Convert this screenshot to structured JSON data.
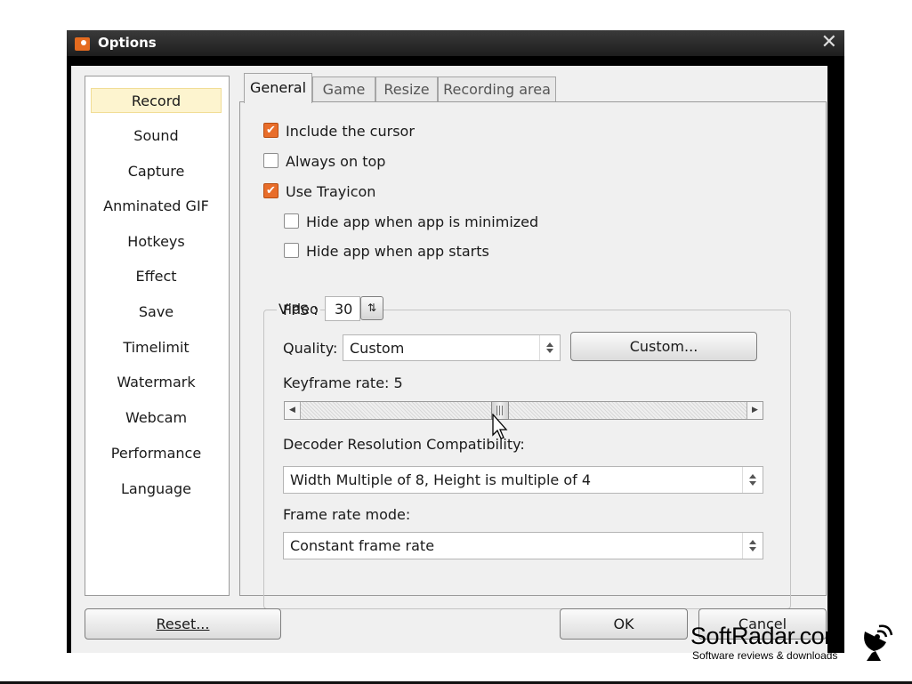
{
  "window": {
    "title": "Options",
    "close_glyph": "✕"
  },
  "nav": {
    "items": [
      {
        "label": "Record",
        "selected": true
      },
      {
        "label": "Sound"
      },
      {
        "label": "Capture"
      },
      {
        "label": "Anminated GIF"
      },
      {
        "label": "Hotkeys"
      },
      {
        "label": "Effect"
      },
      {
        "label": "Save"
      },
      {
        "label": "Timelimit"
      },
      {
        "label": "Watermark"
      },
      {
        "label": "Webcam"
      },
      {
        "label": "Performance"
      },
      {
        "label": "Language"
      }
    ]
  },
  "tabs": [
    {
      "label": "General",
      "active": true
    },
    {
      "label": "Game"
    },
    {
      "label": "Resize"
    },
    {
      "label": "Recording area"
    }
  ],
  "general": {
    "include_cursor": {
      "label": "Include the cursor",
      "checked": true
    },
    "always_on_top": {
      "label": "Always on top",
      "checked": false
    },
    "use_trayicon": {
      "label": "Use Trayicon",
      "checked": true
    },
    "hide_minimized": {
      "label": "Hide app when app is minimized",
      "checked": false
    },
    "hide_starts": {
      "label": "Hide app when app starts",
      "checked": false
    }
  },
  "video": {
    "group_title": "Video",
    "fps_label": "FPS :",
    "fps_value": "30",
    "quality_label": "Quality:",
    "quality_value": "Custom",
    "custom_button": "Custom...",
    "keyframe_label": "Keyframe rate: 5",
    "keyframe_value": 5,
    "decoder_label": "Decoder Resolution Compatibility:",
    "decoder_value": "Width Multiple of 8, Height is multiple of 4",
    "framerate_label": "Frame rate mode:",
    "framerate_value": "Constant frame rate"
  },
  "footer": {
    "reset": "Reset...",
    "ok": "OK",
    "cancel": "Cancel"
  },
  "watermark": {
    "brand": "SoftRadar.com",
    "tagline": "Software reviews & downloads"
  },
  "colors": {
    "accent": "#e86d2a",
    "selection": "#fdf4cf",
    "titlebar": "#2b2b2b"
  },
  "icons": {
    "app": "app-logo-icon",
    "close": "close-icon",
    "spin": "spin-arrows-icon",
    "cursor": "mouse-cursor-icon",
    "dish": "satellite-dish-icon"
  }
}
